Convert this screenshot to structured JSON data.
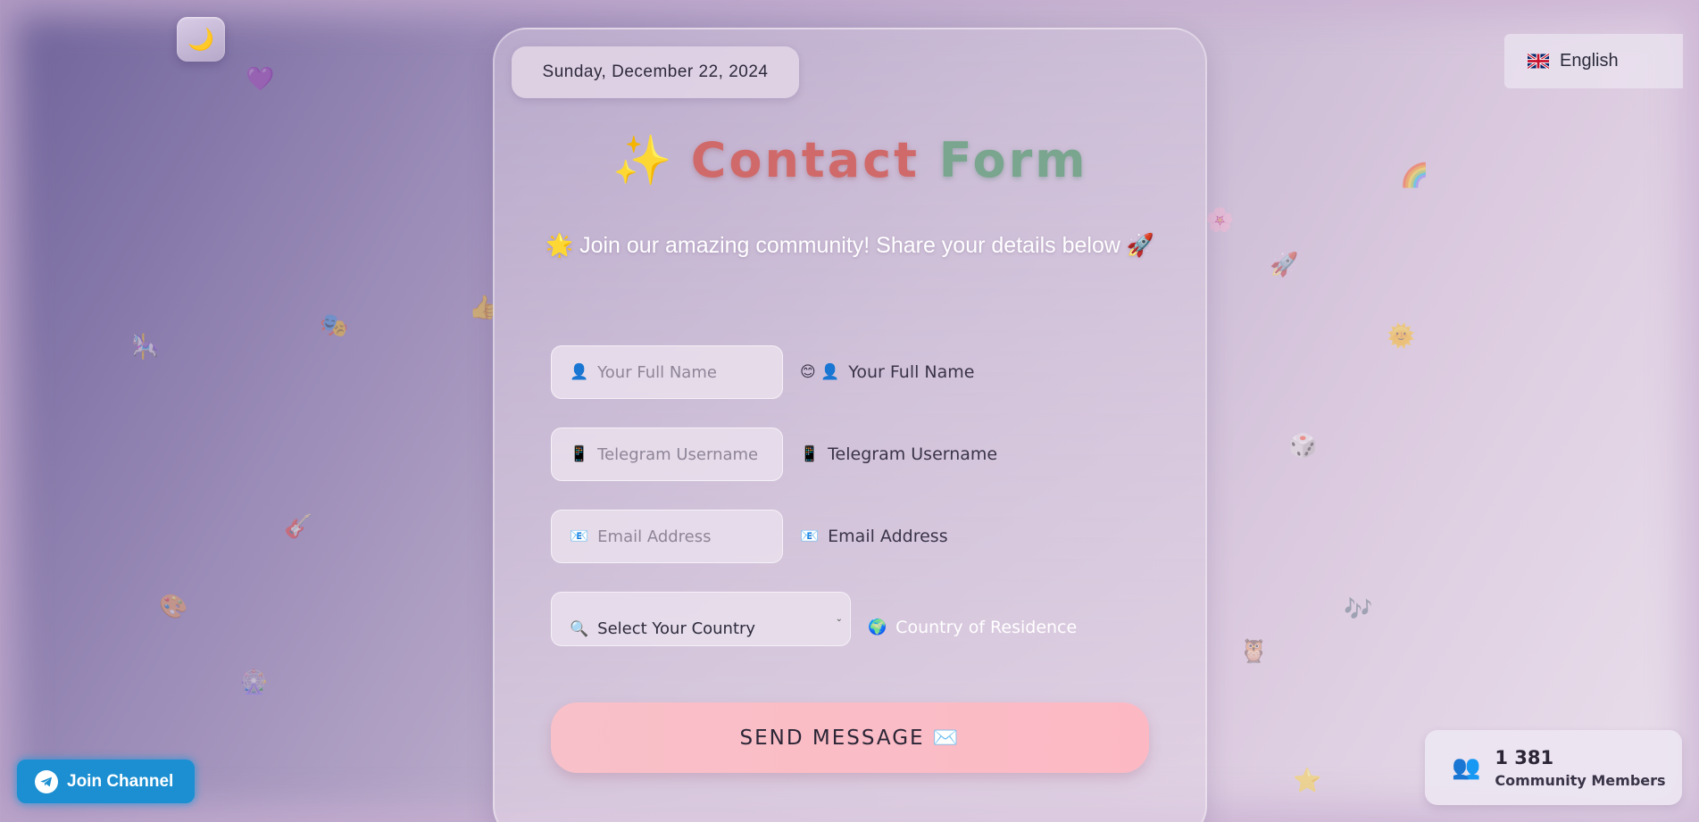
{
  "header": {
    "theme_toggle_icon": "🌙",
    "date": "Sunday, December 22, 2024",
    "language": "English"
  },
  "form": {
    "title_icon": "✨",
    "title_word1": "Contact",
    "title_word2": "Form",
    "subtitle": "🌟 Join our amazing community! Share your details below 🚀",
    "name": {
      "icon": "👤",
      "placeholder": "Your Full Name",
      "label_icons": "😊 👤",
      "label": "Your Full Name"
    },
    "telegram": {
      "icon": "📱",
      "placeholder": "Telegram Username",
      "label_icon": "📱",
      "label": "Telegram Username"
    },
    "email": {
      "icon": "📧",
      "placeholder": "Email Address",
      "label_icon": "📧",
      "label": "Email Address"
    },
    "country": {
      "icon": "🔍",
      "selected": "Select Your Country",
      "label_icon": "🌍",
      "label": "Country of Residence"
    },
    "submit_label": "SEND MESSAGE ✉️"
  },
  "join_channel": {
    "icon": "telegram-icon",
    "label": "Join Channel"
  },
  "community": {
    "icon": "👥",
    "count": "1 381",
    "label": "Community Members"
  },
  "colors": {
    "accent_pink": "#fcb9c4",
    "telegram_blue": "#1b8fd1"
  }
}
